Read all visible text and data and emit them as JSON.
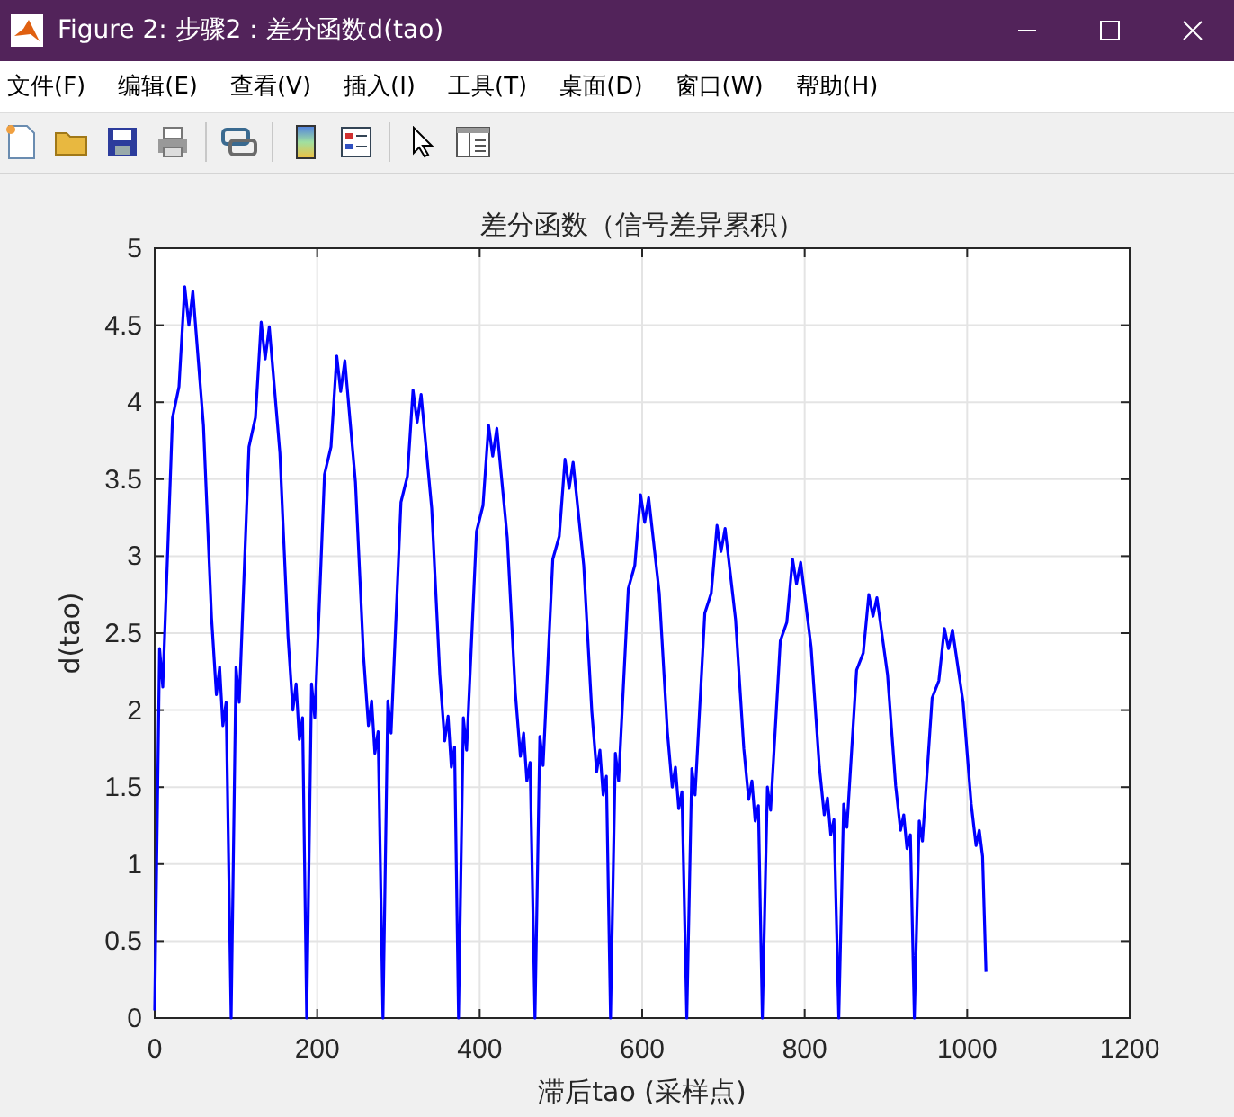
{
  "window": {
    "title": "Figure 2: 步骤2：差分函数d(tao)"
  },
  "menu": [
    {
      "label": "文件(F)"
    },
    {
      "label": "编辑(E)"
    },
    {
      "label": "查看(V)"
    },
    {
      "label": "插入(I)"
    },
    {
      "label": "工具(T)"
    },
    {
      "label": "桌面(D)"
    },
    {
      "label": "窗口(W)"
    },
    {
      "label": "帮助(H)"
    }
  ],
  "chart": {
    "chart_data": {
      "type": "line",
      "grid": true,
      "title": "差分函数（信号差异累积）",
      "xlabel": "滞后tao (采样点)",
      "ylabel": "d(tao)",
      "xlim": [
        0,
        1200
      ],
      "ylim": [
        0,
        5
      ],
      "xticks": [
        0,
        200,
        400,
        600,
        800,
        1000,
        1200
      ],
      "yticks": [
        0,
        {
          "value": 0.5,
          "label": "0.5"
        },
        1,
        {
          "value": 1.5,
          "label": "1.5"
        },
        2,
        {
          "value": 2.5,
          "label": "2.5"
        },
        3,
        {
          "value": 3.5,
          "label": "3.5"
        },
        4,
        {
          "value": 4.5,
          "label": "4.5"
        },
        5
      ],
      "x": [
        0,
        6,
        10,
        22,
        30,
        37,
        42,
        47,
        60,
        70,
        76,
        80,
        84,
        88,
        94,
        100,
        104,
        116,
        124,
        131,
        136,
        141,
        154,
        164,
        170,
        174,
        178,
        182,
        187,
        193,
        197,
        209,
        217,
        224,
        229,
        234,
        247,
        257,
        263,
        267,
        271,
        275,
        281,
        287,
        291,
        303,
        311,
        318,
        323,
        328,
        341,
        351,
        357,
        361,
        365,
        369,
        374,
        380,
        384,
        396,
        404,
        411,
        416,
        421,
        434,
        444,
        450,
        454,
        458,
        462,
        468,
        474,
        478,
        490,
        498,
        505,
        510,
        515,
        528,
        538,
        544,
        548,
        552,
        556,
        561,
        567,
        571,
        583,
        591,
        598,
        603,
        608,
        621,
        631,
        637,
        641,
        645,
        649,
        655,
        661,
        665,
        677,
        685,
        692,
        697,
        702,
        715,
        725,
        731,
        735,
        739,
        743,
        748,
        754,
        758,
        770,
        778,
        785,
        790,
        795,
        808,
        818,
        824,
        828,
        832,
        836,
        842,
        848,
        852,
        864,
        872,
        879,
        884,
        889,
        902,
        912,
        918,
        922,
        926,
        930,
        935,
        941,
        945,
        957,
        965,
        972,
        977,
        982,
        995,
        1005,
        1011,
        1015,
        1019,
        1023
      ],
      "series": [
        {
          "color": "#0000ff",
          "values": [
            0.05,
            2.4,
            2.15,
            3.9,
            4.1,
            4.75,
            4.5,
            4.72,
            3.85,
            2.6,
            2.1,
            2.28,
            1.9,
            2.05,
            0,
            2.28,
            2.05,
            3.71,
            3.9,
            4.52,
            4.28,
            4.49,
            3.67,
            2.48,
            2.0,
            2.17,
            1.81,
            1.95,
            0,
            2.17,
            1.95,
            3.53,
            3.71,
            4.3,
            4.07,
            4.27,
            3.48,
            2.35,
            1.9,
            2.06,
            1.72,
            1.86,
            0,
            2.06,
            1.85,
            3.35,
            3.52,
            4.08,
            3.87,
            4.05,
            3.31,
            2.23,
            1.8,
            1.96,
            1.63,
            1.76,
            0,
            1.95,
            1.74,
            3.16,
            3.33,
            3.85,
            3.65,
            3.83,
            3.12,
            2.11,
            1.7,
            1.85,
            1.54,
            1.66,
            0,
            1.83,
            1.64,
            2.98,
            3.13,
            3.63,
            3.44,
            3.61,
            2.94,
            1.99,
            1.6,
            1.74,
            1.45,
            1.57,
            0,
            1.72,
            1.54,
            2.79,
            2.94,
            3.4,
            3.22,
            3.38,
            2.76,
            1.86,
            1.5,
            1.63,
            1.36,
            1.47,
            0,
            1.62,
            1.45,
            2.63,
            2.76,
            3.2,
            3.03,
            3.18,
            2.59,
            1.75,
            1.42,
            1.54,
            1.28,
            1.38,
            0,
            1.5,
            1.35,
            2.45,
            2.57,
            2.98,
            2.82,
            2.96,
            2.41,
            1.63,
            1.32,
            1.43,
            1.19,
            1.29,
            0,
            1.39,
            1.24,
            2.26,
            2.37,
            2.75,
            2.61,
            2.73,
            2.23,
            1.51,
            1.22,
            1.32,
            1.1,
            1.19,
            0,
            1.28,
            1.15,
            2.08,
            2.19,
            2.53,
            2.4,
            2.52,
            2.05,
            1.39,
            1.12,
            1.22,
            1.05,
            0.3
          ]
        }
      ]
    }
  }
}
